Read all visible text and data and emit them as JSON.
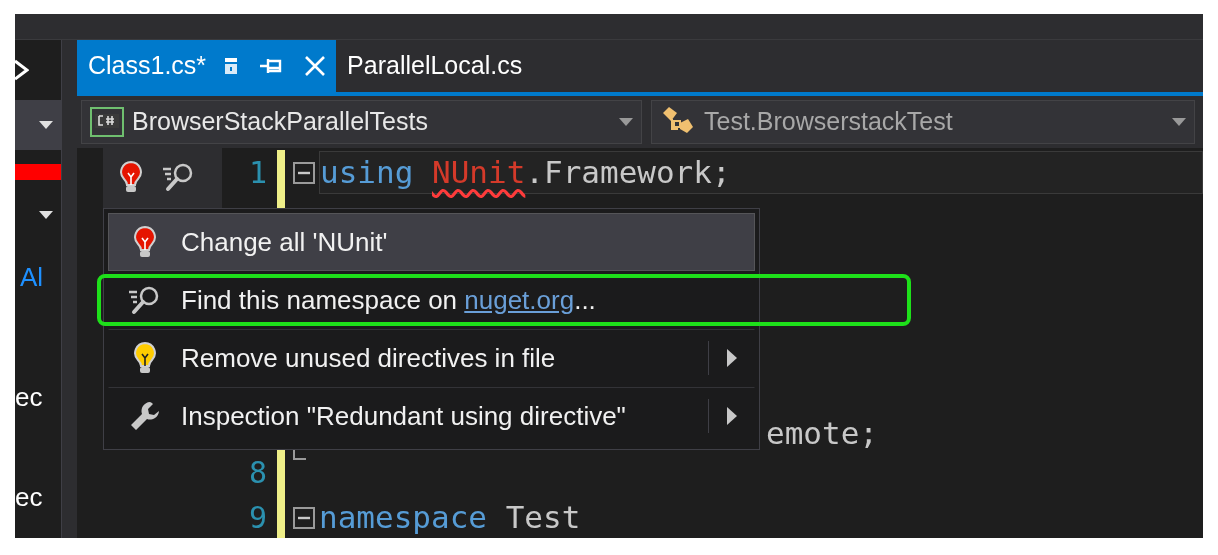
{
  "sidebar": {
    "fragments": [
      {
        "text": "Al",
        "kind": "link"
      },
      {
        "text": "ec",
        "kind": "plain"
      },
      {
        "text": "ec",
        "kind": "plain"
      }
    ]
  },
  "tabs": [
    {
      "label": "Class1.cs*",
      "selected": true
    },
    {
      "label": "ParallelLocal.cs",
      "selected": false
    }
  ],
  "navigation": {
    "project": "BrowserStackParallelTests",
    "member": "Test.BrowserstackTest"
  },
  "code_lines": [
    {
      "number": "1",
      "collapsible": true,
      "block_end": false,
      "partial": false,
      "tokens": [
        {
          "text": "using ",
          "kind": "keyword"
        },
        {
          "text": "NUnit",
          "kind": "error"
        },
        {
          "text": ".Framework;",
          "kind": "plain"
        }
      ]
    },
    {
      "collapsible": false,
      "block_end": true,
      "partial": true,
      "tokens": [
        {
          "text": "emote;",
          "kind": "plain"
        }
      ]
    },
    {
      "number": "8",
      "collapsible": false,
      "block_end": false,
      "partial": false
    },
    {
      "number": "9",
      "collapsible": true,
      "block_end": false,
      "partial": false,
      "tokens": [
        {
          "text": "namespace",
          "kind": "keyword"
        },
        {
          "text": " Test",
          "kind": "plain"
        }
      ]
    }
  ],
  "quick_actions_menu": {
    "items": [
      {
        "kind": "fix",
        "label": "Change all 'NUnit'",
        "selected": true,
        "submenu": false,
        "highlighted": false
      },
      {
        "kind": "search",
        "label": "Find this namespace on ",
        "link": "nuget.org",
        "suffix": "...",
        "selected": false,
        "submenu": false,
        "highlighted": true
      },
      {
        "kind": "suggestion",
        "label": "Remove unused directives in file",
        "selected": false,
        "submenu": true,
        "highlighted": false
      },
      {
        "kind": "inspection",
        "label": "Inspection \"Redundant using directive\"",
        "selected": false,
        "submenu": true,
        "highlighted": false
      }
    ]
  }
}
